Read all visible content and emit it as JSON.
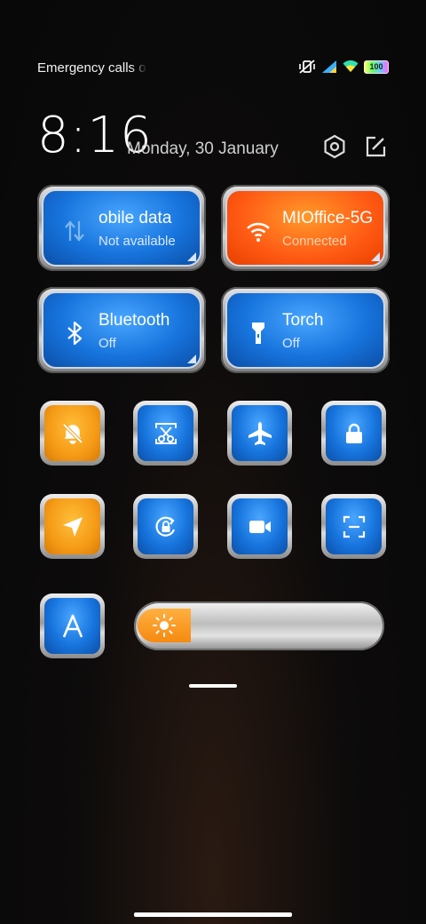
{
  "status_bar": {
    "carrier_text": "Emergency calls o",
    "battery_label": "100"
  },
  "header": {
    "time": "8:16",
    "date": "Monday, 30 January"
  },
  "tiles": {
    "mobile_data": {
      "title": "obile data",
      "subtitle": "Not available"
    },
    "wifi": {
      "title": "MIOffice-5G",
      "subtitle": "Connected"
    },
    "bluetooth": {
      "title": "Bluetooth",
      "subtitle": "Off"
    },
    "torch": {
      "title": "Torch",
      "subtitle": "Off"
    }
  },
  "toggles": [
    {
      "icon": "bell-off-icon",
      "state": "active"
    },
    {
      "icon": "screenshot-scissors-icon",
      "state": "inactive"
    },
    {
      "icon": "airplane-icon",
      "state": "inactive"
    },
    {
      "icon": "lock-icon",
      "state": "inactive"
    },
    {
      "icon": "location-arrow-icon",
      "state": "active"
    },
    {
      "icon": "rotate-lock-icon",
      "state": "inactive"
    },
    {
      "icon": "video-camera-icon",
      "state": "inactive"
    },
    {
      "icon": "scan-icon",
      "state": "inactive"
    },
    {
      "icon": "font-a-icon",
      "state": "inactive"
    }
  ],
  "brightness": {
    "level_percent": 22
  },
  "colors": {
    "active_tile": "#ff5a14",
    "inactive_tile": "#1774dd",
    "amber_tile": "#f59a16"
  }
}
